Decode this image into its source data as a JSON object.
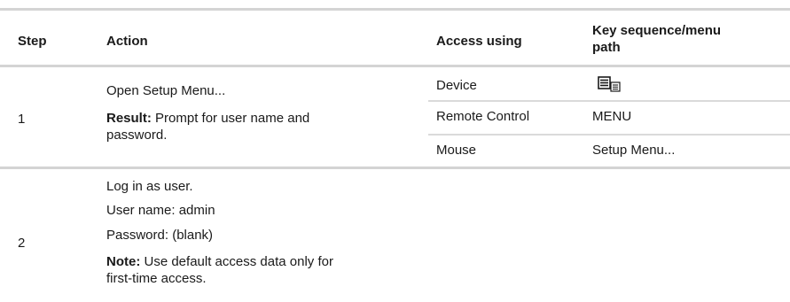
{
  "table": {
    "headers": {
      "step": "Step",
      "action": "Action",
      "access_using": "Access using",
      "key_sequence_line1": "Key sequence/menu",
      "key_sequence_line2": "path"
    },
    "rows": [
      {
        "step": "1",
        "action": "Open Setup Menu...",
        "result_label": "Result:",
        "result_text_line1": " Prompt for user name and",
        "result_text_line2": "password.",
        "access": [
          {
            "method": "Device",
            "key": "menu-button-icon"
          },
          {
            "method": "Remote Control",
            "key": "MENU"
          },
          {
            "method": "Mouse",
            "key": "Setup Menu..."
          }
        ]
      },
      {
        "step": "2",
        "action_line1": "Log in as user.",
        "action_line2": "User name: admin",
        "action_line3": "Password: (blank)",
        "note_label": "Note:",
        "note_text_line1": " Use default access data only for",
        "note_text_line2": "first-time access."
      }
    ]
  }
}
